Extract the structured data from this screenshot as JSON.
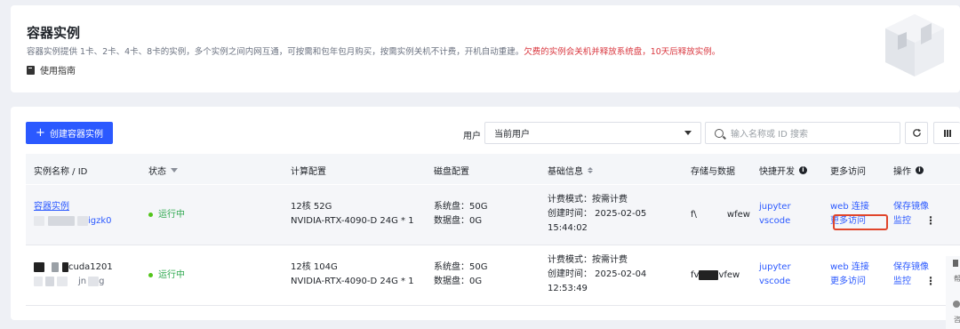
{
  "header": {
    "title": "容器实例",
    "desc_normal": "容器实例提供 1卡、2卡、4卡、8卡的实例，多个实例之间内网互通，可按需和包年包月购买，按需实例关机不计费，开机自动重建。",
    "desc_warning": "欠费的实例会关机并释放系统盘，10天后释放实例。",
    "guide_label": "使用指南"
  },
  "toolbar": {
    "create_label": "创建容器实例",
    "user_label": "用户",
    "user_value": "当前用户",
    "search_placeholder": "输入名称或 ID 搜索"
  },
  "table": {
    "headers": {
      "name": "实例名称 / ID",
      "status": "状态",
      "compute": "计算配置",
      "disk": "磁盘配置",
      "basic": "基础信息",
      "storage": "存储与数据",
      "quick_dev": "快捷开发",
      "more_access": "更多访问",
      "actions": "操作"
    },
    "rows": [
      {
        "name": "容器实例",
        "id_suffix": "igzk0",
        "status": "运行中",
        "cpu_mem": "12核 52G",
        "gpu": "NVIDIA-RTX-4090-D 24G * 1",
        "sys_disk": "系统盘：50G",
        "data_disk": "数据盘：0G",
        "billing": "计费模式：按需计费",
        "created": "创建时间： 2025-02-05",
        "created_time": "15:44:02",
        "storage_a": "f\\",
        "storage_b": "wfew",
        "quick1": "jupyter",
        "quick2": "vscode",
        "access1": "web 连接",
        "access2": "更多访问",
        "action1": "保存镜像",
        "action2": "监控"
      },
      {
        "name_suffix": "cuda1201",
        "id_suffix": "jn",
        "id_tail": "g",
        "status": "运行中",
        "cpu_mem": "12核 104G",
        "gpu": "NVIDIA-RTX-4090-D 24G * 1",
        "sys_disk": "系统盘：50G",
        "data_disk": "数据盘：0G",
        "billing": "计费模式：按需计费",
        "created": "创建时间： 2025-02-04",
        "created_time": "12:53:49",
        "storage_a": "fv",
        "storage_b": "vfew",
        "quick1": "jupyter",
        "quick2": "vscode",
        "access1": "web 连接",
        "access2": "更多访问",
        "action1": "保存镜像",
        "action2": "监控"
      }
    ]
  },
  "side": {
    "t1": "帮",
    "t2": "咨"
  },
  "icons": {
    "guide": "book-icon",
    "search": "search-icon",
    "refresh": "refresh-icon",
    "columns": "columns-icon",
    "filter": "filter-icon",
    "sort": "sort-icon",
    "info": "info-icon",
    "more": "more-vertical-icon"
  },
  "colors": {
    "primary": "#2b59ff",
    "running": "#2ea84f",
    "warning": "#d9363e",
    "highlight": "#e0452b"
  }
}
